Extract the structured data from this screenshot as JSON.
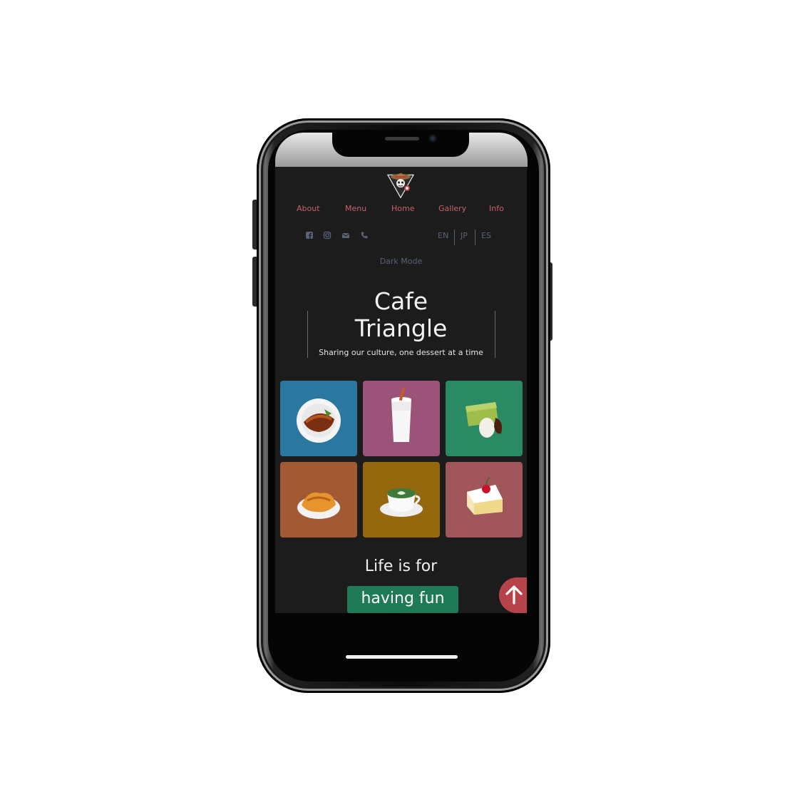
{
  "nav": {
    "items": [
      {
        "label": "About"
      },
      {
        "label": "Menu"
      },
      {
        "label": "Home"
      },
      {
        "label": "Gallery"
      },
      {
        "label": "Info"
      }
    ]
  },
  "social": {
    "icons": [
      "facebook-icon",
      "instagram-icon",
      "email-icon",
      "phone-icon"
    ]
  },
  "languages": [
    "EN",
    "JP",
    "ES"
  ],
  "dark_mode_label": "Dark Mode",
  "hero": {
    "title_line1": "Cafe",
    "title_line2": "Triangle",
    "subtitle": "Sharing our culture, one dessert at a time"
  },
  "tiles": [
    {
      "icon": "cake-plate-icon",
      "color": "#2a77a0"
    },
    {
      "icon": "drink-glass-icon",
      "color": "#9c5379"
    },
    {
      "icon": "matcha-cake-icon",
      "color": "#2a8a64"
    },
    {
      "icon": "pastry-plate-icon",
      "color": "#a25a35"
    },
    {
      "icon": "latte-cup-icon",
      "color": "#95680e"
    },
    {
      "icon": "cherry-cake-icon",
      "color": "#a0565b"
    }
  ],
  "tagline": {
    "text": "Life is for",
    "highlight": "having fun"
  },
  "colors": {
    "background": "#1c1c1d",
    "nav_link": "#c9616b",
    "muted": "#5a6277",
    "highlight": "#1f7a57",
    "scroll_button": "#b7434a"
  }
}
